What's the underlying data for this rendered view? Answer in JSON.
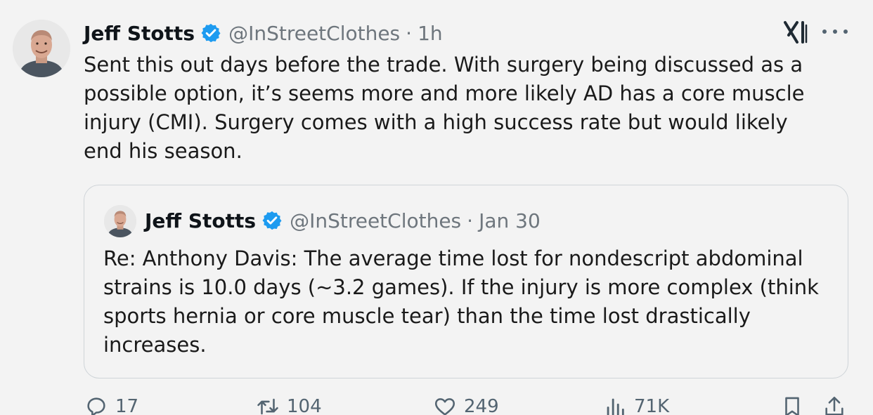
{
  "tweet": {
    "author_name": "Jeff Stotts",
    "handle": "@InStreetClothes",
    "separator": "·",
    "time": "1h",
    "text": "Sent this out days before the trade. With surgery being discussed as a possible option, it’s seems more and more likely AD has a core muscle injury (CMI). Surgery comes with a high success rate but would likely end his season."
  },
  "quoted": {
    "author_name": "Jeff Stotts",
    "handle": "@InStreetClothes",
    "separator": "·",
    "time": "Jan 30",
    "text": "Re: Anthony Davis: The average time lost for nondescript abdominal strains is 10.0 days (~3.2 games). If the injury is more complex (think sports hernia or core muscle tear) than the time lost drastically increases."
  },
  "actions": {
    "replies": "17",
    "retweets": "104",
    "likes": "249",
    "views": "71K"
  },
  "icons": {
    "verified": "verified-badge-icon",
    "logo": "x-logo-icon",
    "more": "more-options-icon",
    "reply": "reply-icon",
    "retweet": "retweet-icon",
    "like": "heart-icon",
    "views": "views-icon",
    "bookmark": "bookmark-icon",
    "share": "share-icon"
  },
  "colors": {
    "verified": "#1d9bf0",
    "secondary_text": "#6e767d",
    "background": "#f3f3f3"
  }
}
